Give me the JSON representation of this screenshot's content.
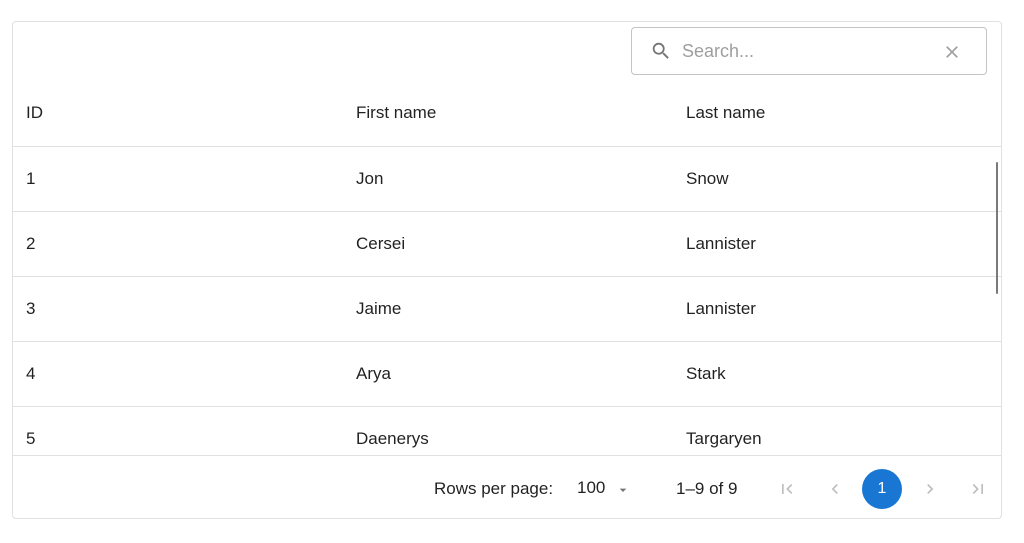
{
  "toolbar": {
    "search": {
      "placeholder": "Search...",
      "value": ""
    }
  },
  "table": {
    "columns": [
      "ID",
      "First name",
      "Last name"
    ],
    "rows": [
      [
        "1",
        "Jon",
        "Snow"
      ],
      [
        "2",
        "Cersei",
        "Lannister"
      ],
      [
        "3",
        "Jaime",
        "Lannister"
      ],
      [
        "4",
        "Arya",
        "Stark"
      ],
      [
        "5",
        "Daenerys",
        "Targaryen"
      ]
    ]
  },
  "footer": {
    "rows_per_page_label": "Rows per page:",
    "rows_per_page_value": "100",
    "range_text": "1–9 of 9",
    "current_page": "1"
  },
  "colors": {
    "accent": "#1976d2",
    "border": "#e0e0e0",
    "icon": "#757575"
  }
}
